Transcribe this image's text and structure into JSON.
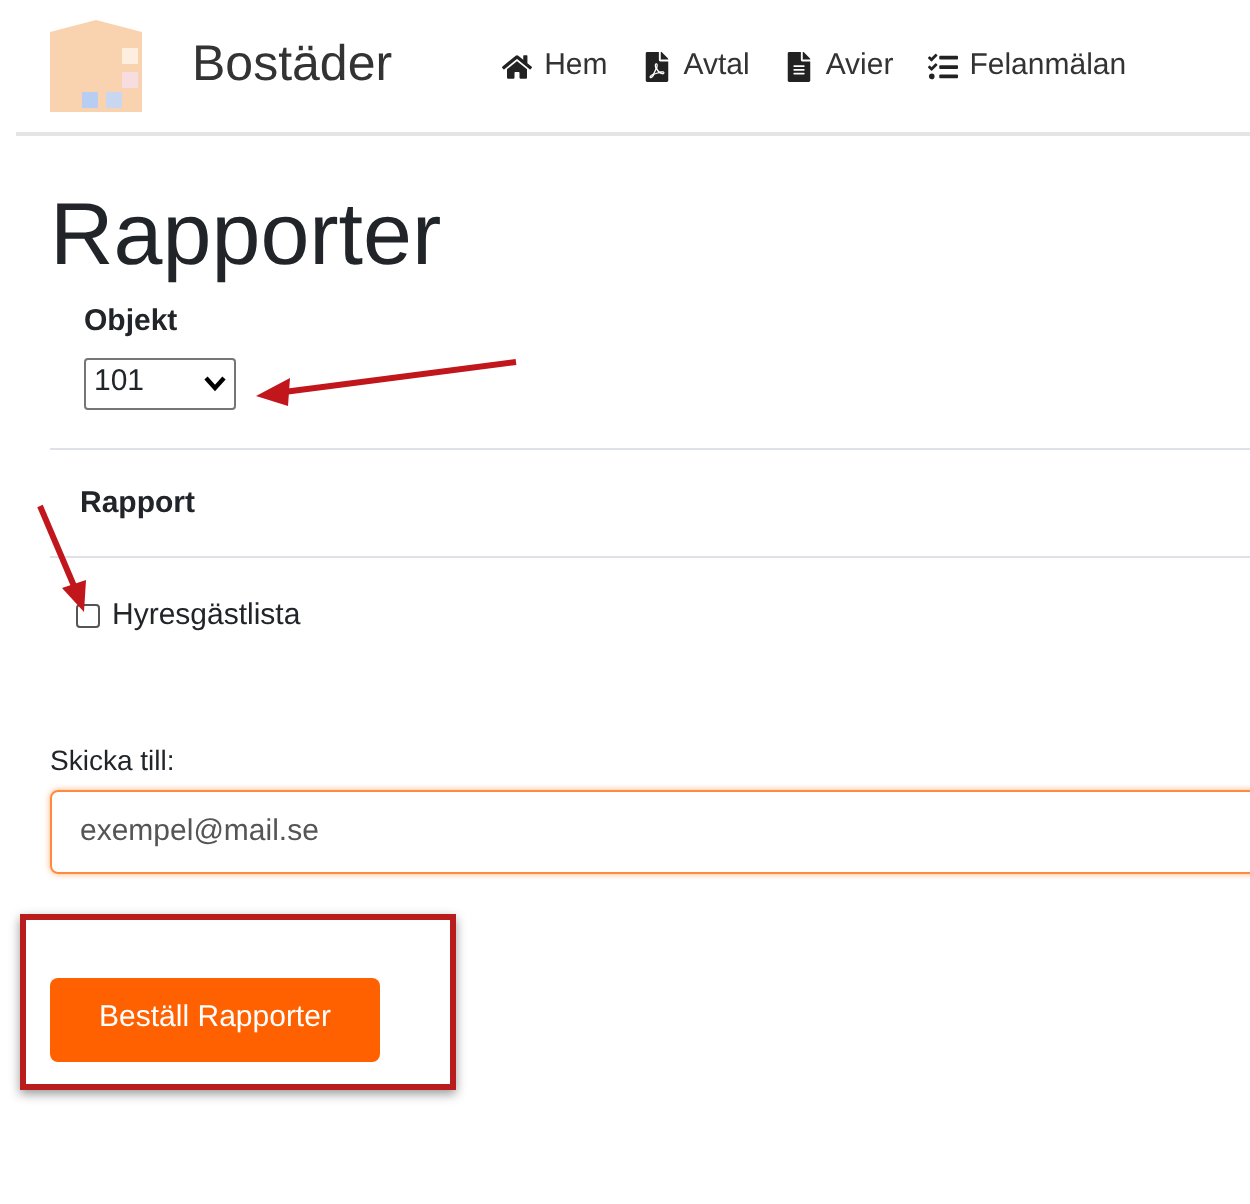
{
  "brand": "Bostäder",
  "nav": [
    {
      "label": "Hem"
    },
    {
      "label": "Avtal"
    },
    {
      "label": "Avier"
    },
    {
      "label": "Felanmälan"
    }
  ],
  "title": "Rapporter",
  "object_label": "Objekt",
  "object_select": {
    "value": "101"
  },
  "report_heading": "Rapport",
  "reports": [
    {
      "label": "Hyresgästlista",
      "checked": false
    }
  ],
  "send_to": {
    "label": "Skicka till:",
    "placeholder": "exempel@mail.se"
  },
  "submit": "Beställ Rapporter"
}
